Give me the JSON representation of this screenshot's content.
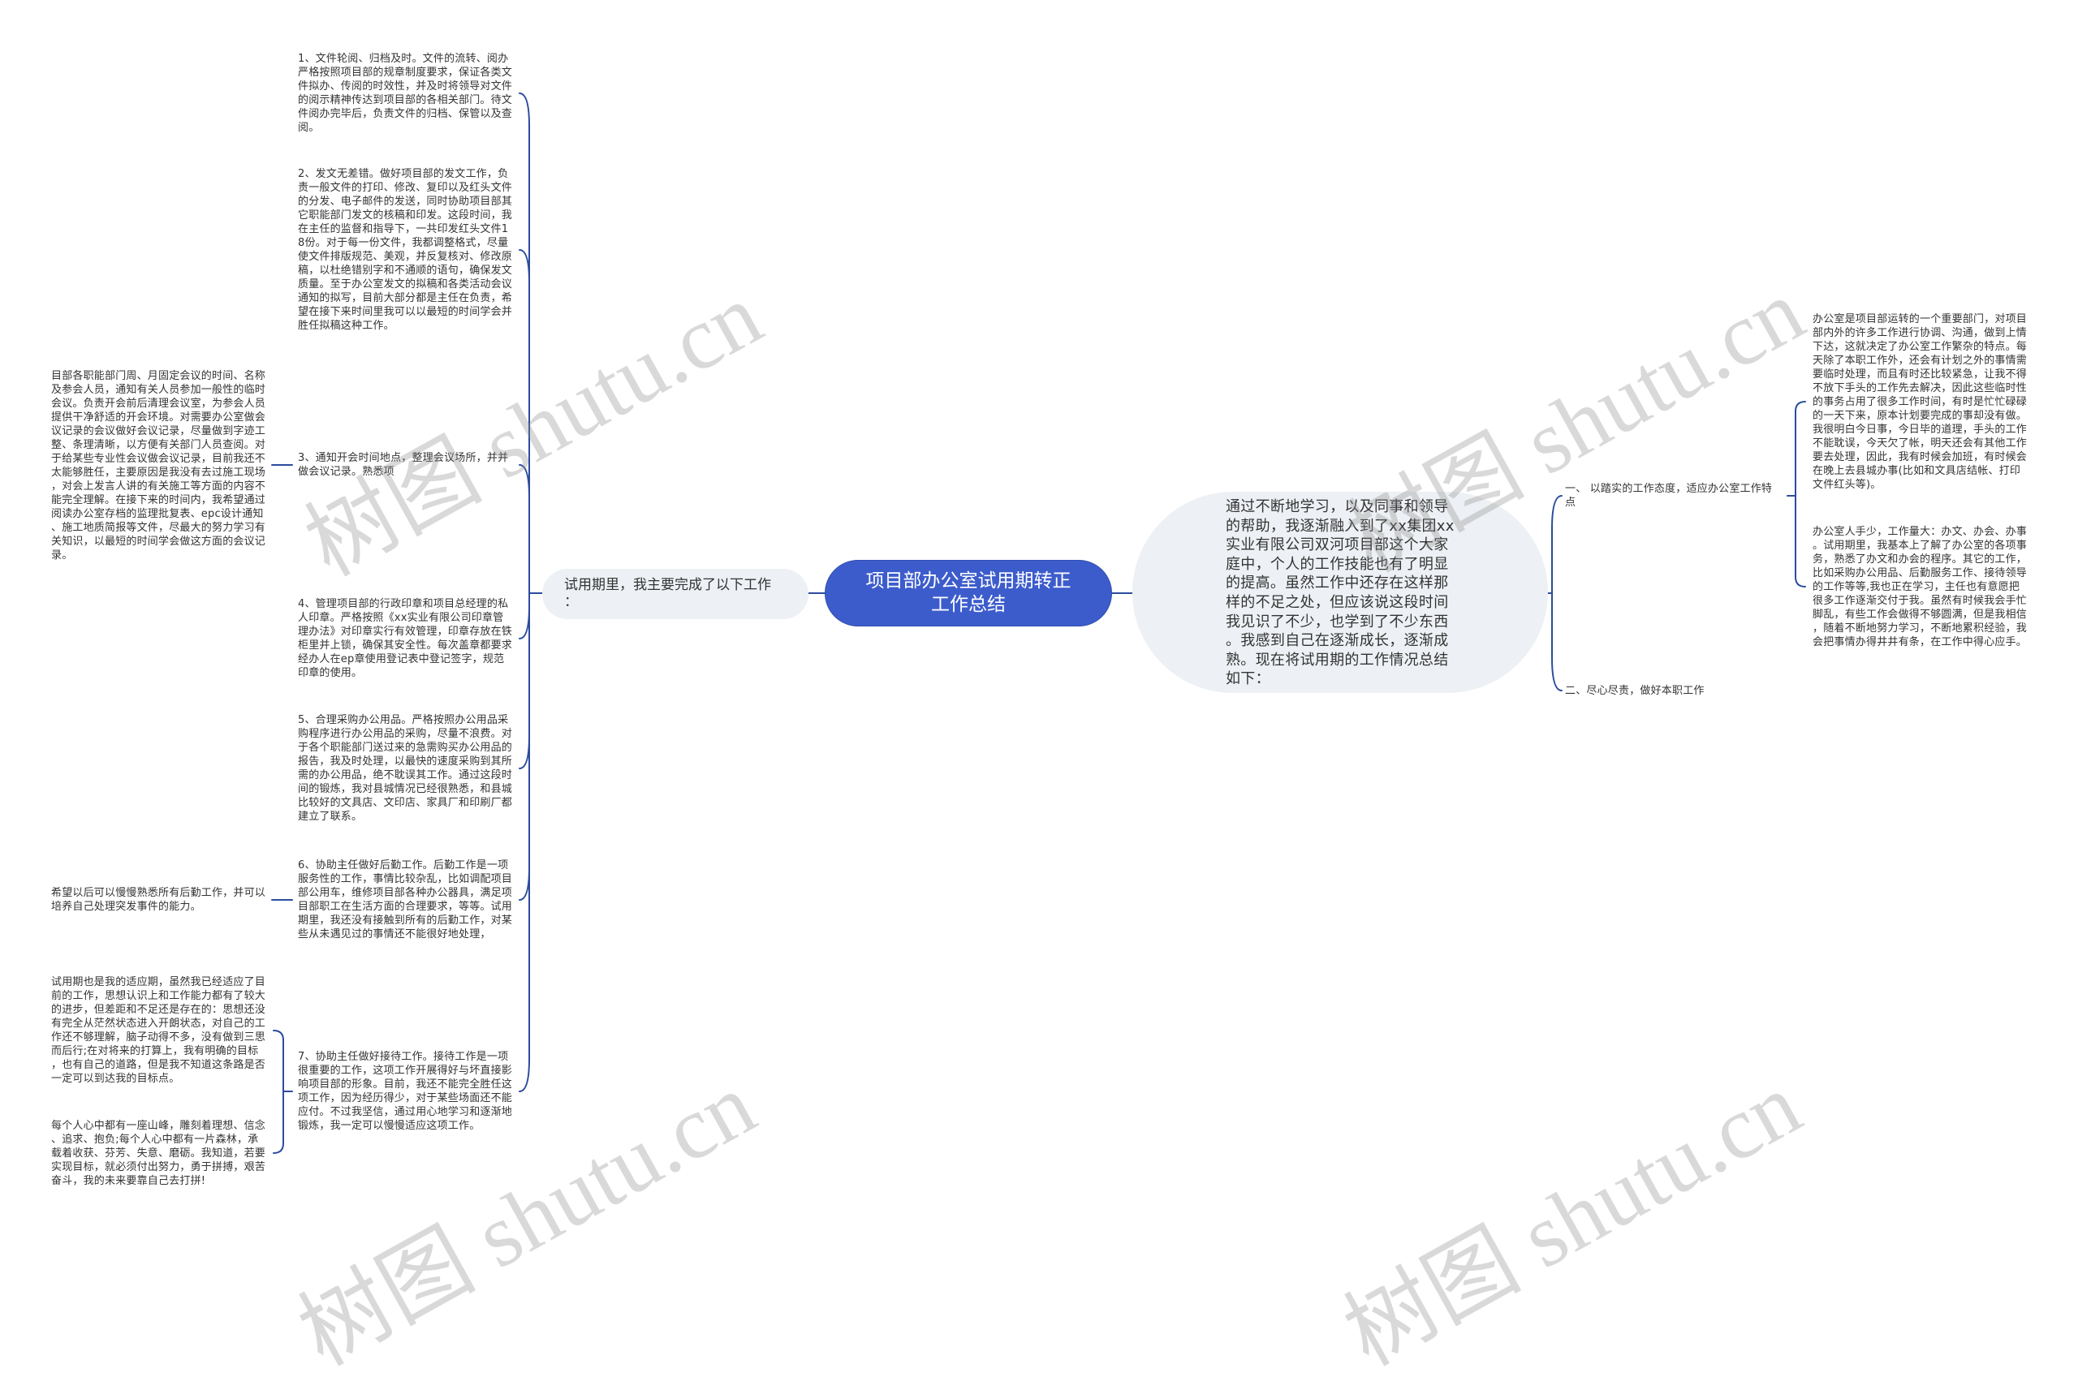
{
  "colors": {
    "root_bg": "#3d5ccc",
    "root_border": "#2f4dae",
    "line": "#2b4c9e",
    "node_bg": "#edf0f4",
    "text": "#333333",
    "root_text": "#ffffff"
  },
  "root": {
    "text": "项目部办公室试用期转正\n工作总结"
  },
  "left_branch": {
    "text": "试用期里，我主要完成了以下工作\n：",
    "items": [
      {
        "text": "1、文件轮阅、归档及时。文件的流转、阅办\n严格按照项目部的规章制度要求，保证各类文\n件拟办、传阅的时效性，并及时将领导对文件\n的阅示精神传达到项目部的各相关部门。待文\n件阅办完毕后，负责文件的归档、保管以及查\n阅。"
      },
      {
        "text": "2、发文无差错。做好项目部的发文工作，负\n责一般文件的打印、修改、复印以及红头文件\n的分发、电子邮件的发送，同时协助项目部其\n它职能部门发文的核稿和印发。这段时间，我\n在主任的监督和指导下，一共印发红头文件1\n8份。对于每一份文件，我都调整格式，尽量\n使文件排版规范、美观，并反复核对、修改原\n稿，以杜绝错别字和不通顺的语句，确保发文\n质量。至于办公室发文的拟稿和各类活动会议\n通知的拟写，目前大部分都是主任在负责，希\n望在接下来时间里我可以以最短的时间学会并\n胜任拟稿这种工作。"
      },
      {
        "text": "3、通知开会时间地点，整理会议场所，并并\n做会议记录。熟悉项",
        "children": [
          {
            "text": "目部各职能部门周、月固定会议的时间、名称\n及参会人员，通知有关人员参加一般性的临时\n会议。负责开会前后清理会议室，为参会人员\n提供干净舒适的开会环境。对需要办公室做会\n议记录的会议做好会议记录，尽量做到字迹工\n整、条理清晰，以方便有关部门人员查阅。对\n于给某些专业性会议做会议记录，目前我还不\n太能够胜任，主要原因是我没有去过施工现场\n，对会上发言人讲的有关施工等方面的内容不\n能完全理解。在接下来的时间内，我希望通过\n阅读办公室存档的监理批复表、epc设计通知\n、施工地质简报等文件，尽最大的努力学习有\n关知识，以最短的时间学会做这方面的会议记\n录。"
          }
        ]
      },
      {
        "text": "4、管理项目部的行政印章和项目总经理的私\n人印章。严格按照《xx实业有限公司印章管\n理办法》对印章实行有效管理，印章存放在铁\n柜里并上锁，确保其安全性。每次盖章都要求\n经办人在ep章使用登记表中登记签字，规范\n印章的使用。"
      },
      {
        "text": "5、合理采购办公用品。严格按照办公用品采\n购程序进行办公用品的采购，尽量不浪费。对\n于各个职能部门送过来的急需购买办公用品的\n报告，我及时处理，以最快的速度采购到其所\n需的办公用品，绝不耽误其工作。通过这段时\n间的锻炼，我对县城情况已经很熟悉，和县城\n比较好的文具店、文印店、家具厂和印刷厂都\n建立了联系。"
      },
      {
        "text": "6、协助主任做好后勤工作。后勤工作是一项\n服务性的工作，事情比较杂乱，比如调配项目\n部公用车，维修项目部各种办公器具，满足项\n目部职工在生活方面的合理要求，等等。试用\n期里，我还没有接触到所有的后勤工作，对某\n些从未遇见过的事情还不能很好地处理，",
        "children": [
          {
            "text": "希望以后可以慢慢熟悉所有后勤工作，并可以\n培养自己处理突发事件的能力。"
          }
        ]
      },
      {
        "text": "7、协助主任做好接待工作。接待工作是一项\n很重要的工作，这项工作开展得好与坏直接影\n响项目部的形象。目前，我还不能完全胜任这\n项工作，因为经历得少，对于某些场面还不能\n应付。不过我坚信，通过用心地学习和逐渐地\n锻炼，我一定可以慢慢适应这项工作。",
        "children": [
          {
            "text": "试用期也是我的适应期，虽然我已经适应了目\n前的工作，思想认识上和工作能力都有了较大\n的进步，但差距和不足还是存在的：思想还没\n有完全从茫然状态进入开朗状态，对自己的工\n作还不够理解，脑子动得不多，没有做到三思\n而后行;在对将来的打算上，我有明确的目标\n，也有自己的道路，但是我不知道这条路是否\n一定可以到达我的目标点。"
          },
          {
            "text": "每个人心中都有一座山峰，雕刻着理想、信念\n、追求、抱负;每个人心中都有一片森林，承\n载着收获、芬芳、失意、磨砺。我知道，若要\n实现目标，就必须付出努力，勇于拼搏，艰苦\n奋斗，我的未来要靠自己去打拼!"
          }
        ]
      }
    ]
  },
  "right_branch": {
    "text": "通过不断地学习，以及同事和领导\n的帮助，我逐渐融入到了xx集团xx\n实业有限公司双河项目部这个大家\n庭中，个人的工作技能也有了明显\n的提高。虽然工作中还存在这样那\n样的不足之处，但应该说这段时间\n我见识了不少，也学到了不少东西\n。我感到自己在逐渐成长，逐渐成\n熟。现在将试用期的工作情况总结\n如下：",
    "items": [
      {
        "text": "一、 以踏实的工作态度，适应办公室工作特\n点",
        "children": [
          {
            "text": "办公室是项目部运转的一个重要部门，对项目\n部内外的许多工作进行协调、沟通，做到上情\n下达，这就决定了办公室工作繁杂的特点。每\n天除了本职工作外，还会有计划之外的事情需\n要临时处理，而且有时还比较紧急，让我不得\n不放下手头的工作先去解决，因此这些临时性\n的事务占用了很多工作时间，有时是忙忙碌碌\n的一天下来，原本计划要完成的事却没有做。\n我很明白今日事，今日毕的道理，手头的工作\n不能耽误，今天欠了帐，明天还会有其他工作\n要去处理，因此，我有时候会加班，有时候会\n在晚上去县城办事(比如和文具店结帐、打印\n文件红头等)。"
          },
          {
            "text": "办公室人手少，工作量大：办文、办会、办事\n。试用期里，我基本上了解了办公室的各项事\n务，熟悉了办文和办会的程序。其它的工作，\n比如采购办公用品、后勤服务工作、接待领导\n的工作等等,我也正在学习，主任也有意愿把\n很多工作逐渐交付于我。虽然有时候我会手忙\n脚乱，有些工作会做得不够圆满，但是我相信\n，随着不断地努力学习，不断地累积经验，我\n会把事情办得井井有条，在工作中得心应手。"
          }
        ]
      },
      {
        "text": "二、尽心尽责，做好本职工作"
      }
    ]
  },
  "watermark": {
    "text": "树图 shutu.cn"
  }
}
